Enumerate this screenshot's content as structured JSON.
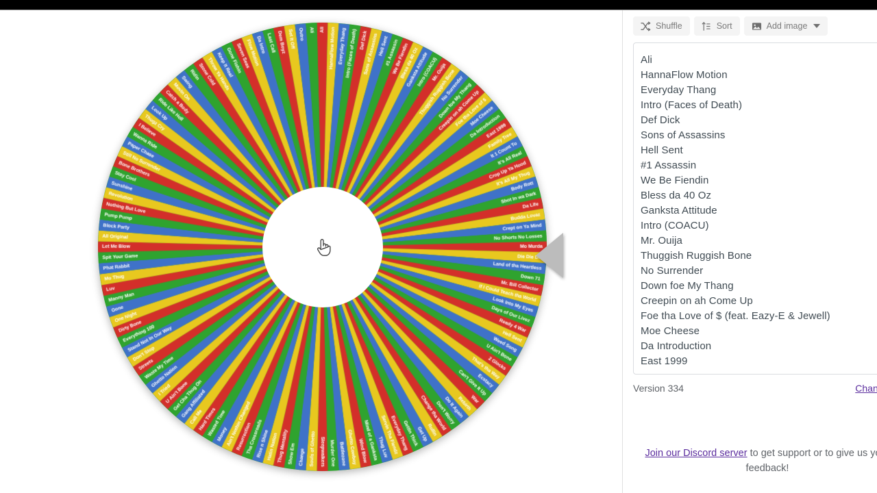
{
  "app": {
    "version_label": "Version 334",
    "changelog_label": "Changelog"
  },
  "toolbar": {
    "shuffle_label": "Shuffle",
    "shuffle_icon": "shuffle-icon",
    "sort_label": "Sort",
    "sort_icon": "sort-az-icon",
    "add_image_label": "Add image",
    "add_image_icon": "image-icon",
    "add_image_caret_icon": "chevron-down-icon"
  },
  "entries_list": {
    "items": [
      "Ali",
      "HannaFlow Motion",
      "Everyday Thang",
      "Intro (Faces of Death)",
      "Def Dick",
      "Sons of Assassins",
      "Hell Sent",
      "#1 Assassin",
      "We Be Fiendin",
      "Bless da 40 Oz",
      "Ganksta Attitude",
      "Intro (COACU)",
      "Mr. Ouija",
      "Thuggish Ruggish Bone",
      "No Surrender",
      "Down foe My Thang",
      "Creepin on ah Come Up",
      "Foe tha Love of $ (feat. Eazy-E & Jewell)",
      "Moe Cheese",
      "Da Introduction",
      "East 1999"
    ]
  },
  "footer": {
    "discord_link_label": "Join our Discord server",
    "discord_text_rest": " to get support or to give us your feedback!"
  },
  "wheel": {
    "pointer_icon": "wheel-pointer-triangle",
    "cursor_icon": "pointing-hand-cursor",
    "segment_count": 128,
    "segment_colors": [
      "#d32f2a",
      "#e8c81f",
      "#3f72c8",
      "#2fa32f"
    ],
    "label_text_color": "#ffffff",
    "hub_color": "#ffffff",
    "pointer_color": "#bcbcbc",
    "labels": [
      "Ali",
      "HannaFlow Motion",
      "Everyday Thang",
      "Intro (Faces of Death)",
      "Def Dick",
      "Sons of Assassins",
      "Hell Sent",
      "#1 Assassin",
      "We Be Fiendin",
      "Bless da 40 Oz",
      "Ganksta Attitude",
      "Intro (COACU)",
      "Mr. Ouija",
      "Thuggish Ruggish Bone",
      "No Surrender",
      "Down foe My Thang",
      "Creepin on ah Come Up",
      "Foe tha Love of $",
      "Moe Cheese",
      "Da Introduction",
      "East 1999",
      "Family Tree",
      "It 1 Count To",
      "It's All Real",
      "Crop Up Ya Hood",
      "It's All My Thug",
      "Body Rott",
      "Shot In wa Dark",
      "Da Life",
      "Budda Lovaz",
      "Crept on Ya Mind",
      "No Shorts No Losses",
      "Mo Murda",
      "Die Die Die",
      "Land of tha Heartless",
      "Down 71",
      "Mr. Bill Collector",
      "If I Could Teach tha World",
      "Look Into My Eyes",
      "Days of Our Livez",
      "Ready 4 War",
      "Hell Sent",
      "Weed Song",
      "U Ain't Bone",
      "2 Glocks",
      "That's tha Way",
      "Ecstacy",
      "Can't Give It Up",
      "War",
      "Rebirth",
      "Do It Again",
      "Don't Worry",
      "Change tha World",
      "Rollin",
      "Get Up",
      "Gettin Thick",
      "Everyday Thang",
      "Servin Tha Fiendz",
      "Thug Luv",
      "Mind of a Ganksta",
      "Wind Blow",
      "Ghetto Cowboy",
      "Battlezone",
      "Murder One",
      "Sleepwalkers",
      "Souls of Ghetto",
      "Change",
      "Show Em",
      "Thug Mentality",
      "Hatin Nation",
      "Rise n Shine",
      "Tha Crossroads",
      "Resurrection",
      "Ain't Nothin Changed",
      "Money",
      "Wasted Time",
      "Hard Times",
      "Call Me",
      "Gang Affiliated",
      "Get Cha Thug On",
      "U Ain't Bone",
      "I Tried",
      "Ghetto Nation",
      "Waste My Time",
      "Streets",
      "Don't Stop",
      "Stand Not In Our Way",
      "Everything 100",
      "Dirty Bone",
      "One Night",
      "Gone",
      "Manny Man",
      "Luv",
      "Mo Thug",
      "Phat Rabbit",
      "Spit Your Game",
      "Let Me Blow",
      "All Original",
      "Block Party",
      "Pump Pump",
      "Nothing But Love",
      "Revolution",
      "Sunshine",
      "Stay Cool",
      "Bone Brothers",
      "Still No Surrender",
      "Paper Chase",
      "Wanna Ride",
      "I Believe",
      "Thugz Cry",
      "Look Up",
      "Ride Like Hell",
      "Catch a Body",
      "Movin On",
      "Swing",
      "Ridin",
      "Stone Cold",
      "Throw Ya Hands",
      "Keep It Real",
      "Gone Fishin",
      "Seven Seas",
      "Flow Motion",
      "Da Intro",
      "Last Call",
      "Dem Boyz",
      "Set It Off",
      "Outro"
    ]
  }
}
